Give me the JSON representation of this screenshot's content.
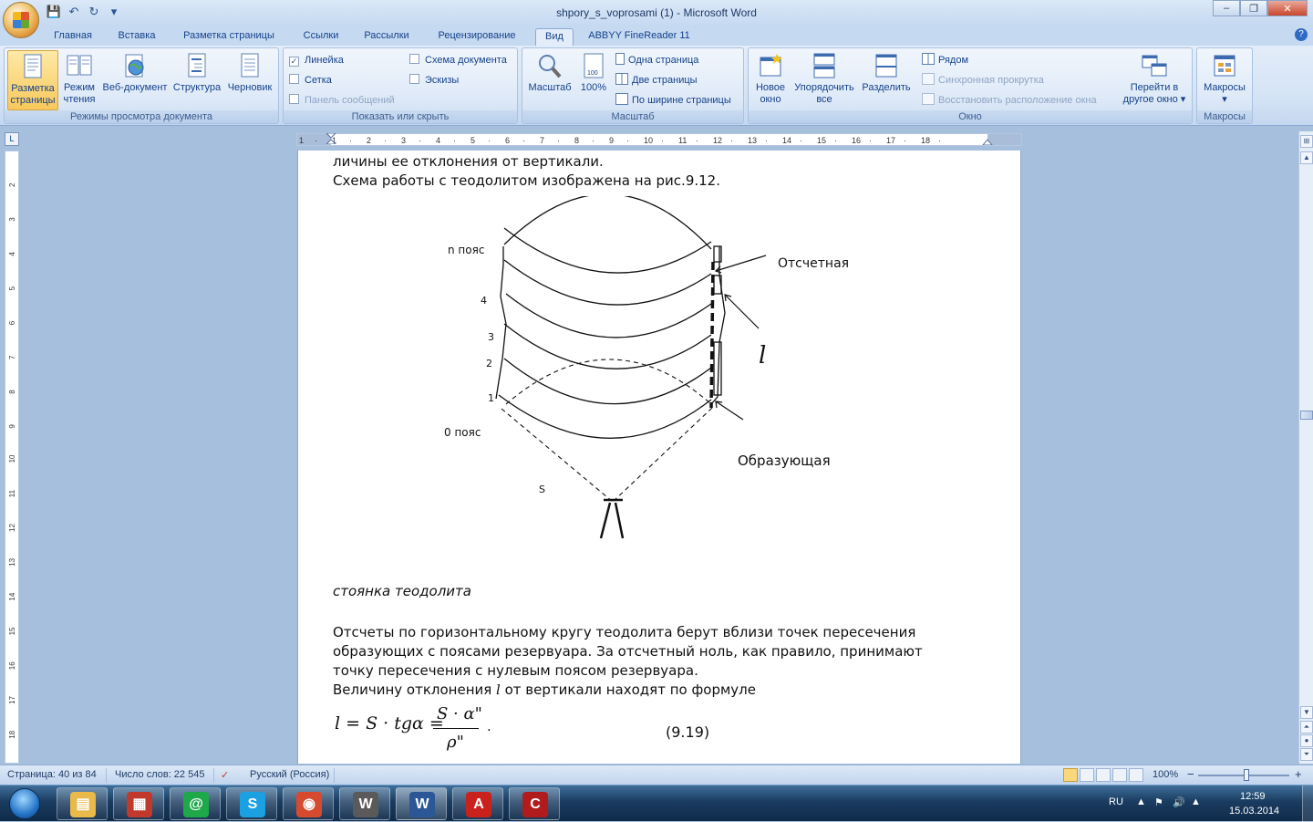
{
  "window": {
    "title": "shpory_s_voprosami (1) - Microsoft Word",
    "controls": {
      "minimize": "–",
      "restore": "❐",
      "close": "✕"
    }
  },
  "qat": {
    "save": "💾",
    "undo": "↶",
    "redo": "↻",
    "customize": "▾"
  },
  "tabs": [
    "Главная",
    "Вставка",
    "Разметка страницы",
    "Ссылки",
    "Рассылки",
    "Рецензирование",
    "Вид",
    "ABBYY FineReader 11"
  ],
  "active_tab": "Вид",
  "help": "?",
  "ribbon": {
    "views": {
      "group_label": "Режимы просмотра документа",
      "buttons": [
        {
          "label1": "Разметка",
          "label2": "страницы"
        },
        {
          "label1": "Режим",
          "label2": "чтения"
        },
        {
          "label1": "Веб-документ",
          "label2": ""
        },
        {
          "label1": "Структура",
          "label2": ""
        },
        {
          "label1": "Черновик",
          "label2": ""
        }
      ]
    },
    "show": {
      "group_label": "Показать или скрыть",
      "ruler": "Линейка",
      "grid": "Сетка",
      "message_bar": "Панель сообщений",
      "doc_map": "Схема документа",
      "thumbnails": "Эскизы",
      "check": "✓"
    },
    "zoom": {
      "group_label": "Масштаб",
      "zoom_btn": "Масштаб",
      "percent_btn": "100%",
      "percent_icon_text": "100",
      "one_page": "Одна страница",
      "two_pages": "Две страницы",
      "page_width": "По ширине страницы"
    },
    "window": {
      "group_label": "Окно",
      "new_window1": "Новое",
      "new_window2": "окно",
      "arrange1": "Упорядочить",
      "arrange2": "все",
      "split": "Разделить",
      "side_by_side": "Рядом",
      "sync_scroll": "Синхронная прокрутка",
      "reset_pos": "Восстановить расположение окна",
      "switch1": "Перейти в",
      "switch2": "другое окно ▾"
    },
    "macros": {
      "group_label": "Макросы",
      "button": "Макросы",
      "arrow": "▾"
    }
  },
  "ruler": {
    "button": "L",
    "h_numbers": [
      "1",
      "·",
      "1",
      "·",
      "2",
      "·",
      "3",
      "·",
      "4",
      "·",
      "5",
      "·",
      "6",
      "·",
      "7",
      "·",
      "8",
      "·",
      "9",
      "·",
      "10",
      "·",
      "11",
      "·",
      "12",
      "·",
      "13",
      "·",
      "14",
      "·",
      "15",
      "·",
      "16",
      "·",
      "17",
      "·",
      "18",
      "·"
    ],
    "v_numbers": [
      "2",
      "3",
      "4",
      "5",
      "6",
      "7",
      "8",
      "9",
      "10",
      "11",
      "12",
      "13",
      "14",
      "15",
      "16",
      "17",
      "18"
    ]
  },
  "document": {
    "line1": "личины ее отклонения от вертикали.",
    "line2": "Схема работы с теодолитом изображена на рис.9.12.",
    "diagram": {
      "n_belt": "n пояс",
      "label_4": "4",
      "label_3": "3",
      "label_2": "2",
      "label_1": "1",
      "zero_belt": "0 пояс",
      "reading": "Отсчетная",
      "l_symbol": "l",
      "generatrix": "Образующая",
      "s_label": "S"
    },
    "caption": "стоянка теодолита",
    "p1_l1": "Отсчеты по горизонтальному кругу теодолита берут вблизи точек пересечения",
    "p1_l2": "образующих с поясами резервуара. За отсчетный ноль, как правило, принимают",
    "p1_l3": "точку пересечения с нулевым поясом резервуара.",
    "p2_pre": "Величину отклонения ",
    "p2_l": "l",
    "p2_post": " от вертикали находят по формуле",
    "formula": {
      "lhs": "l = S · tgα =",
      "numerator": "S · α\"",
      "denominator": "ρ\"",
      "period": ".",
      "number": "(9.19)"
    }
  },
  "statusbar": {
    "page": "Страница: 40 из 84",
    "words": "Число слов: 22 545",
    "language": "Русский (Россия)",
    "zoom": "100%",
    "zoom_out": "−",
    "zoom_in": "+"
  },
  "taskbar": {
    "lang": "RU",
    "time": "12:59",
    "date": "15.03.2014",
    "apps": [
      {
        "name": "explorer",
        "glyph": "▤",
        "color": "#e9b949"
      },
      {
        "name": "apps",
        "glyph": "▦",
        "color": "#c0392b"
      },
      {
        "name": "mail-agent",
        "glyph": "@",
        "color": "#1fa84a"
      },
      {
        "name": "skype",
        "glyph": "S",
        "color": "#1ba1e2"
      },
      {
        "name": "chrome",
        "glyph": "◉",
        "color": "#d64b2f"
      },
      {
        "name": "world-of-tanks",
        "glyph": "W",
        "color": "#5a5a5a"
      },
      {
        "name": "word",
        "glyph": "W",
        "color": "#2b5797"
      },
      {
        "name": "acrobat",
        "glyph": "A",
        "color": "#c9221c"
      },
      {
        "name": "red-app",
        "glyph": "C",
        "color": "#b01c1c"
      }
    ]
  },
  "colors": {
    "accent": "#15428b",
    "ribbon": "#d3e2f5",
    "workspace": "#a5bfdd"
  }
}
